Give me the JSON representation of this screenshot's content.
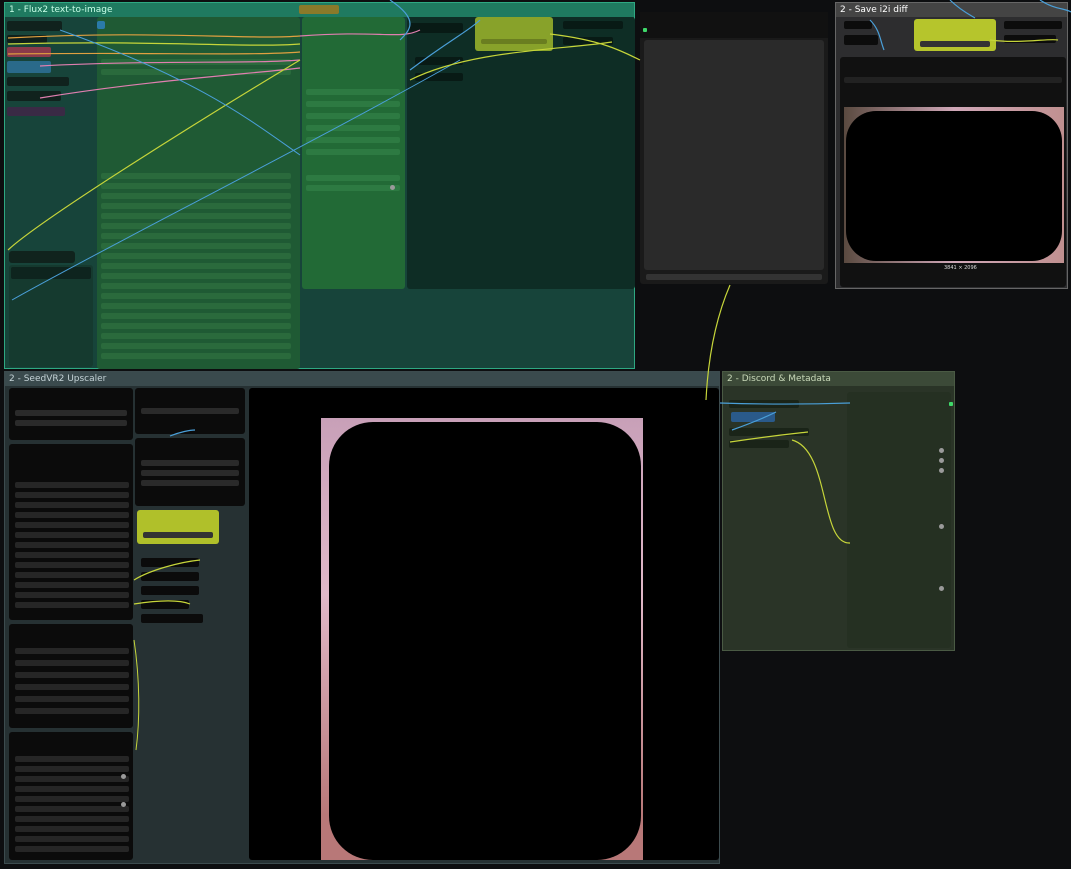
{
  "groups": {
    "flux": {
      "title": "1 - Flux2 text-to-image",
      "color": "#3fd9a5"
    },
    "save": {
      "title": "2 - Save i2i diff",
      "color": "#ffffff"
    },
    "seedvr": {
      "title": "2 - SeedVR2 Upscaler",
      "color": "#8fa3a8"
    },
    "discord": {
      "title": "2 - Discord & Metadata",
      "color": "#a8b89a"
    }
  },
  "save_preview": {
    "caption": "3841 × 2096"
  },
  "colors": {
    "flux_bg": "#1b4a3c",
    "flux_border": "#2ea882",
    "seed_bg": "#263032",
    "discord_bg": "#2b3527",
    "accent_node": "#a9b82a",
    "wire_blue": "#4a9fd8",
    "wire_yellow": "#c6d53a",
    "wire_pink": "#e07fb0",
    "wire_orange": "#e0a040"
  }
}
